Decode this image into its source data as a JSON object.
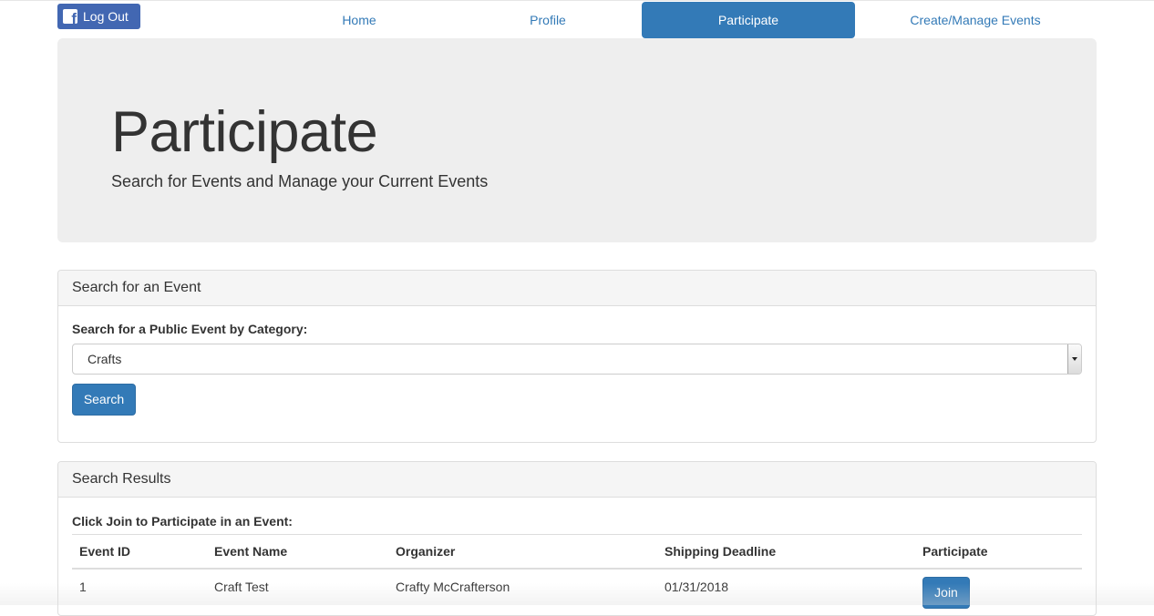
{
  "header": {
    "logout_label": "Log Out",
    "nav": [
      {
        "label": "Home"
      },
      {
        "label": "Profile"
      },
      {
        "label": "Participate"
      },
      {
        "label": "Create/Manage Events"
      }
    ],
    "active_tab": "Participate"
  },
  "jumbotron": {
    "title": "Participate",
    "subtitle": "Search for Events and Manage your Current Events"
  },
  "search_panel": {
    "heading": "Search for an Event",
    "label": "Search for a Public Event by Category:",
    "selected_category": "Crafts",
    "button_label": "Search"
  },
  "results_panel": {
    "heading": "Search Results",
    "instruction": "Click Join to Participate in an Event:",
    "columns": [
      "Event ID",
      "Event Name",
      "Organizer",
      "Shipping Deadline",
      "Participate"
    ],
    "rows": [
      {
        "event_id": "1",
        "event_name": "Craft Test",
        "organizer": "Crafty McCrafterson",
        "shipping_deadline": "01/31/2018",
        "action_label": "Join"
      }
    ]
  },
  "colors": {
    "brand_facebook": "#4267b2",
    "accent": "#337ab7",
    "jumbotron_bg": "#eeeeee",
    "panel_heading_bg": "#f5f5f5"
  },
  "icons": {
    "logout": "facebook-icon",
    "select": "dropdown-arrow-icon"
  }
}
